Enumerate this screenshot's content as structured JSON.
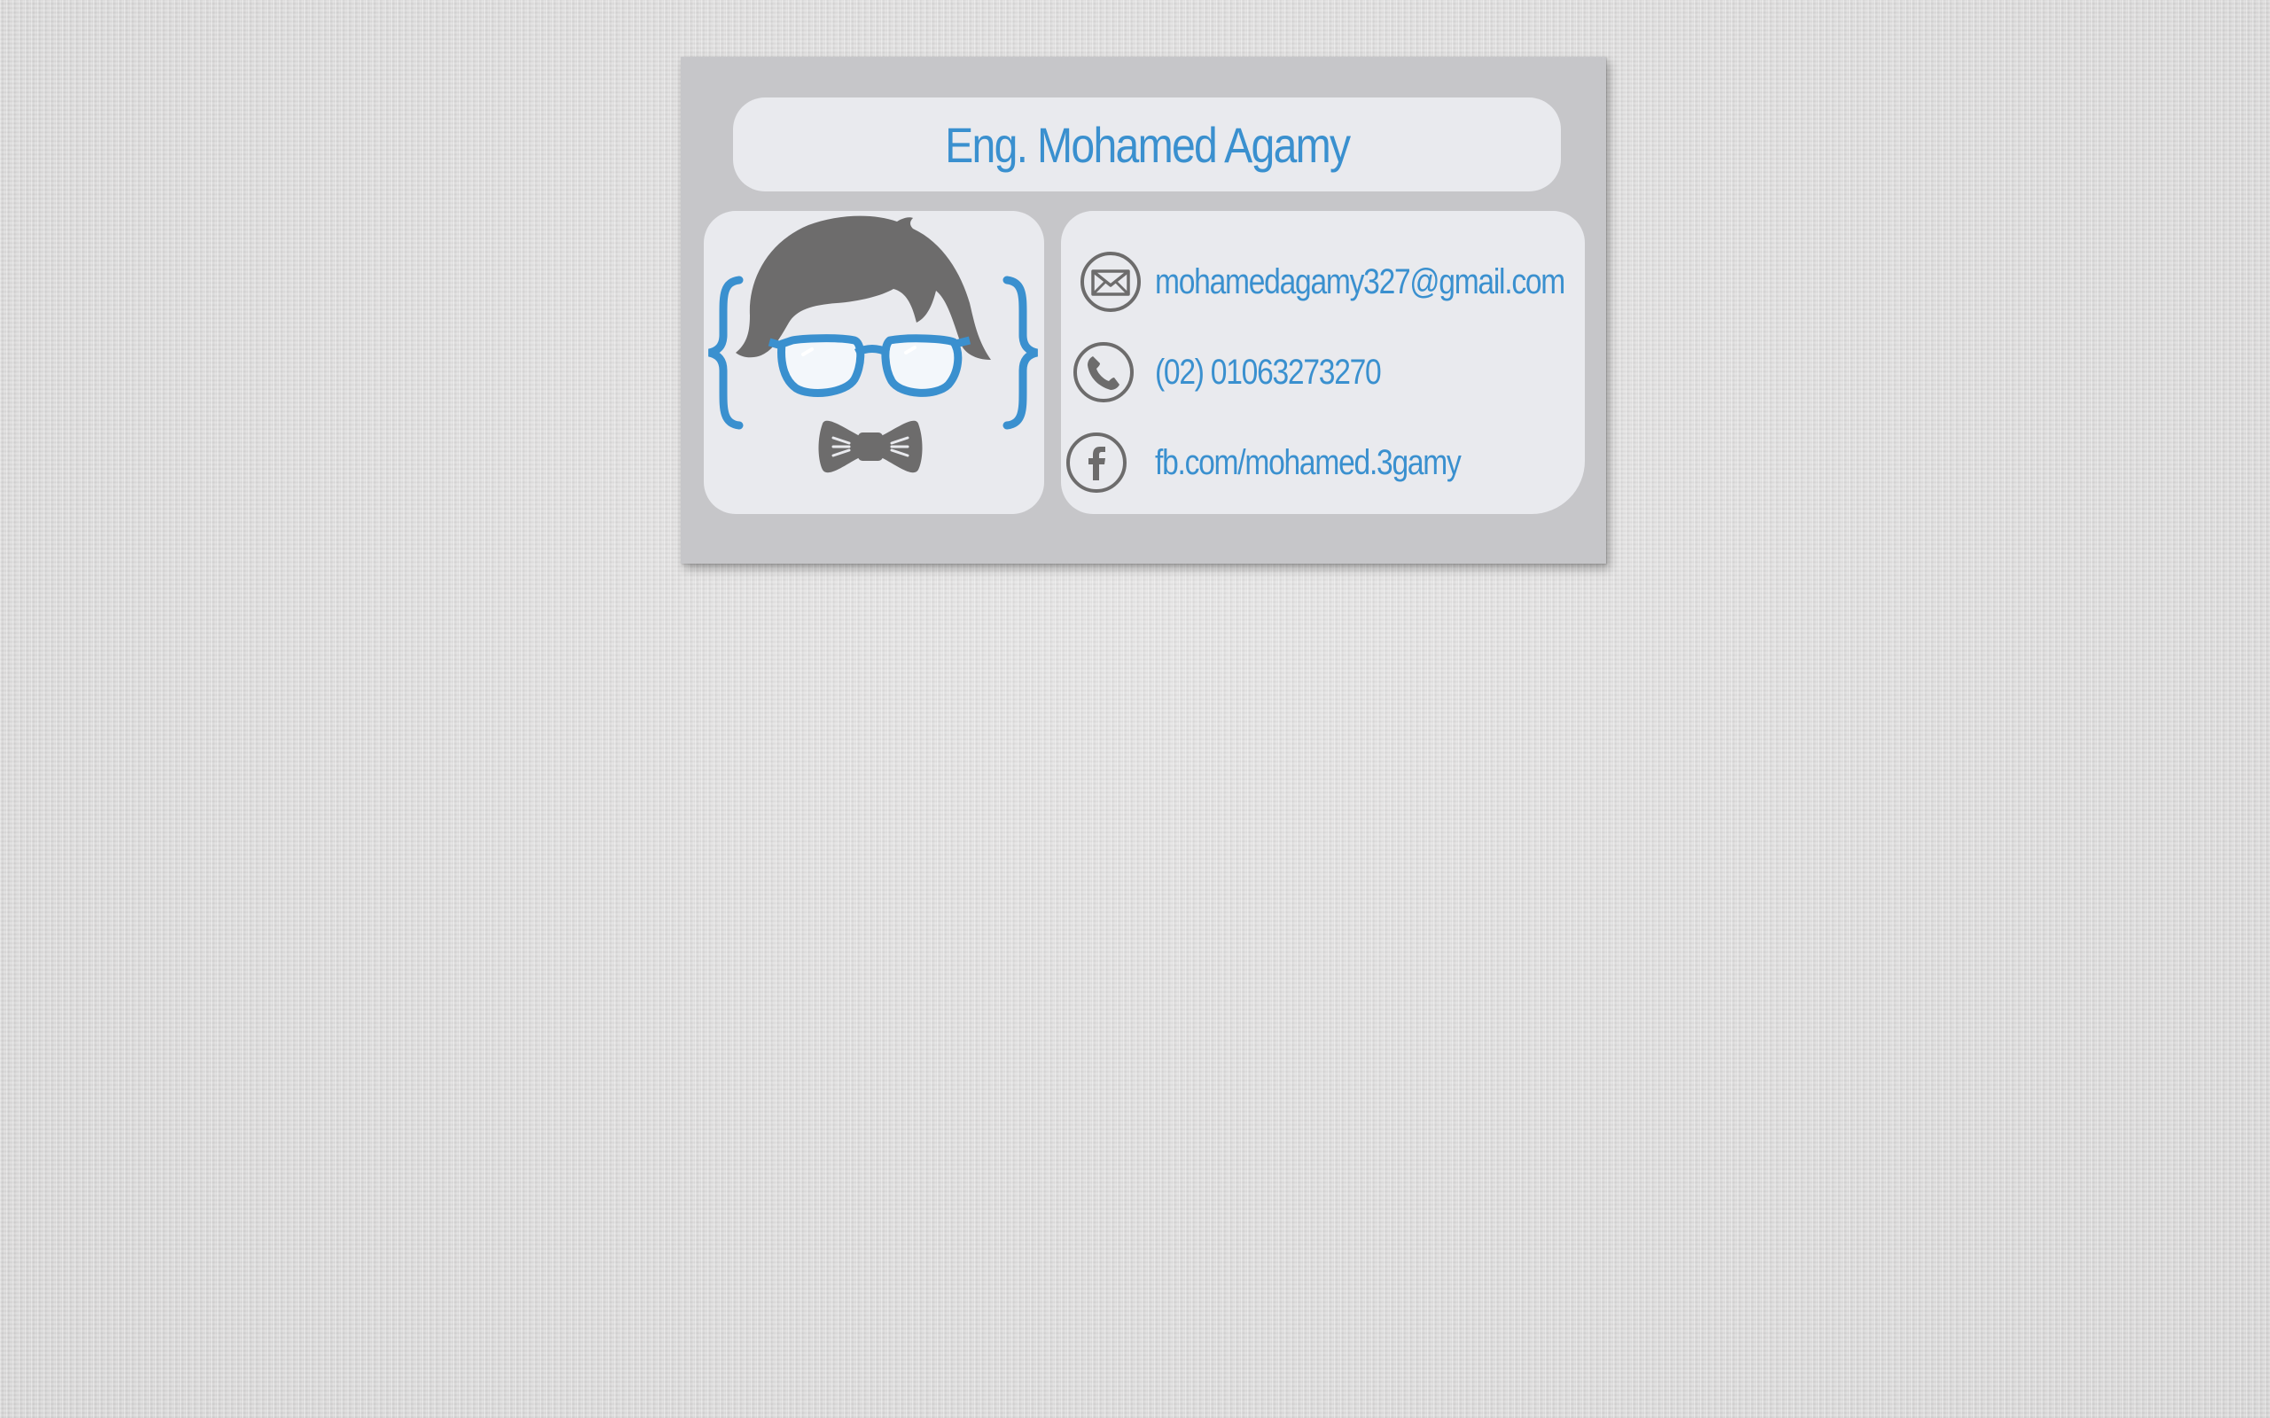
{
  "card": {
    "name": "Eng. Mohamed Agamy",
    "contacts": [
      {
        "icon": "envelope-icon",
        "text": "mohamedagamy327@gmail.com"
      },
      {
        "icon": "phone-icon",
        "text": "(02) 01063273270"
      },
      {
        "icon": "facebook-icon",
        "text": "fb.com/mohamed.3gamy"
      }
    ],
    "avatar": "nerd-avatar-with-glasses-and-bowtie"
  },
  "colors": {
    "card_background": "#c6c6c9",
    "panel_background": "#e9eaee",
    "accent_blue": "#3a90cf",
    "icon_gray": "#6d6c6c",
    "wall": "#dddcdc"
  }
}
